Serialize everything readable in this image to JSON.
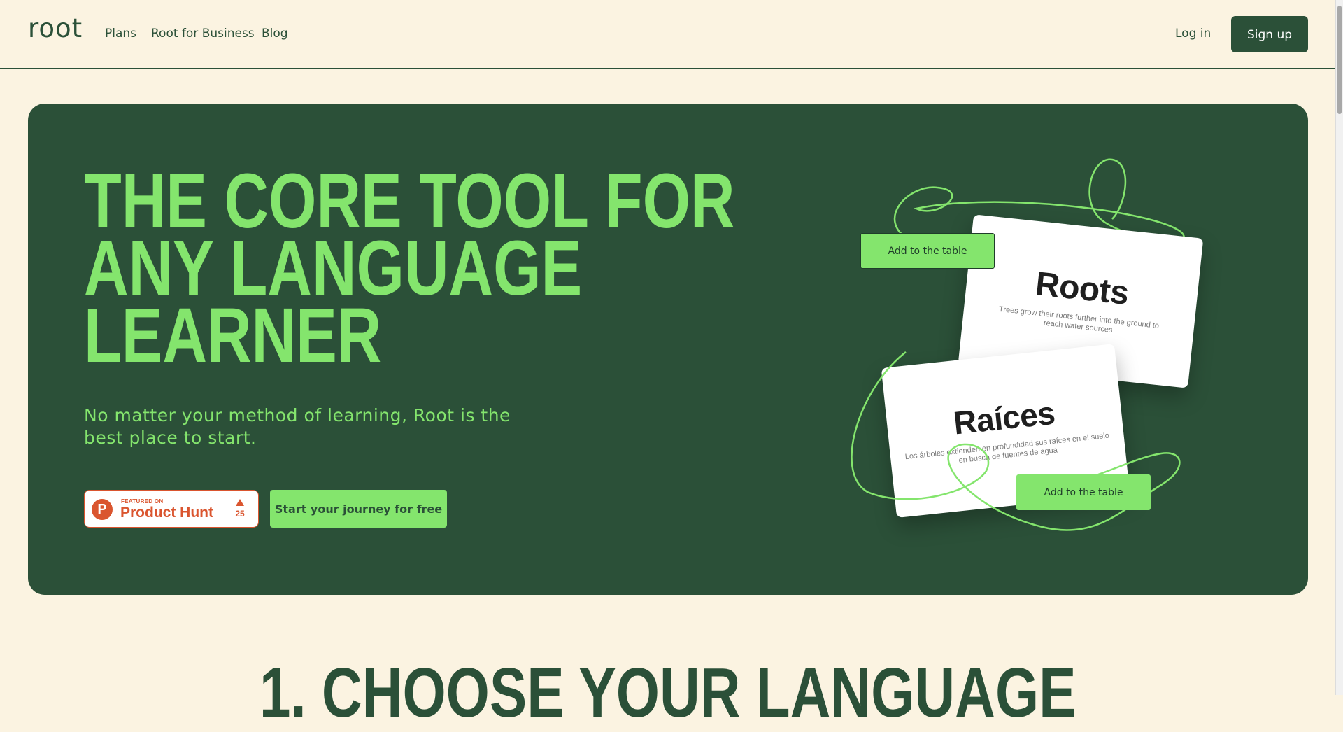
{
  "header": {
    "logo": "root",
    "nav": [
      "Plans",
      "Root for Business",
      "Blog"
    ],
    "login_label": "Log in",
    "signup_label": "Sign up"
  },
  "hero": {
    "title_lines": [
      "THE CORE TOOL FOR",
      "ANY LANGUAGE",
      "LEARNER"
    ],
    "subtitle": "No matter your method of learning, Root is the best place to start.",
    "product_hunt": {
      "featured": "FEATURED ON",
      "name": "Product Hunt",
      "count": "25"
    },
    "cta_label": "Start your journey for free",
    "cards": {
      "roots": {
        "word": "Roots",
        "sentence": "Trees grow their roots further into the ground to reach water sources"
      },
      "raices": {
        "word": "Raíces",
        "sentence": "Los árboles extienden en profundidad sus raíces en el suelo en busca de fuentes de agua"
      }
    },
    "add_button_label": "Add to the table"
  },
  "section": {
    "heading": "1. CHOOSE YOUR LANGUAGE"
  },
  "colors": {
    "background": "#fbf3e1",
    "brand_dark": "#2b5038",
    "accent_green": "#84e56d",
    "product_hunt": "#da552f"
  }
}
